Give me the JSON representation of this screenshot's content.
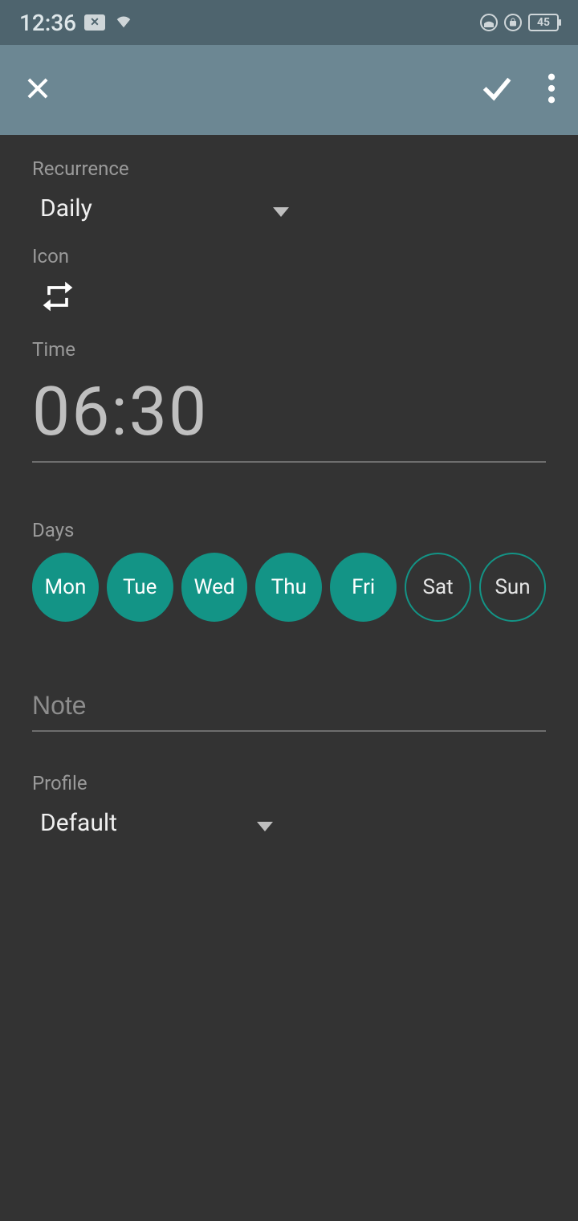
{
  "statusbar": {
    "time": "12:36",
    "battery": "45"
  },
  "appbar": {
    "close_label": "Close",
    "confirm_label": "Confirm",
    "more_label": "More options"
  },
  "recurrence": {
    "label": "Recurrence",
    "value": "Daily"
  },
  "icon_section": {
    "label": "Icon",
    "icon_name": "repeat-icon"
  },
  "time": {
    "label": "Time",
    "value": "06:30"
  },
  "days": {
    "label": "Days",
    "items": [
      {
        "label": "Mon",
        "selected": true
      },
      {
        "label": "Tue",
        "selected": true
      },
      {
        "label": "Wed",
        "selected": true
      },
      {
        "label": "Thu",
        "selected": true
      },
      {
        "label": "Fri",
        "selected": true
      },
      {
        "label": "Sat",
        "selected": false
      },
      {
        "label": "Sun",
        "selected": false
      }
    ]
  },
  "note": {
    "placeholder": "Note",
    "value": ""
  },
  "profile": {
    "label": "Profile",
    "value": "Default"
  },
  "colors": {
    "accent": "#139486",
    "appbar": "#6c8793",
    "statusbar": "#4e646e",
    "bg": "#333333"
  }
}
